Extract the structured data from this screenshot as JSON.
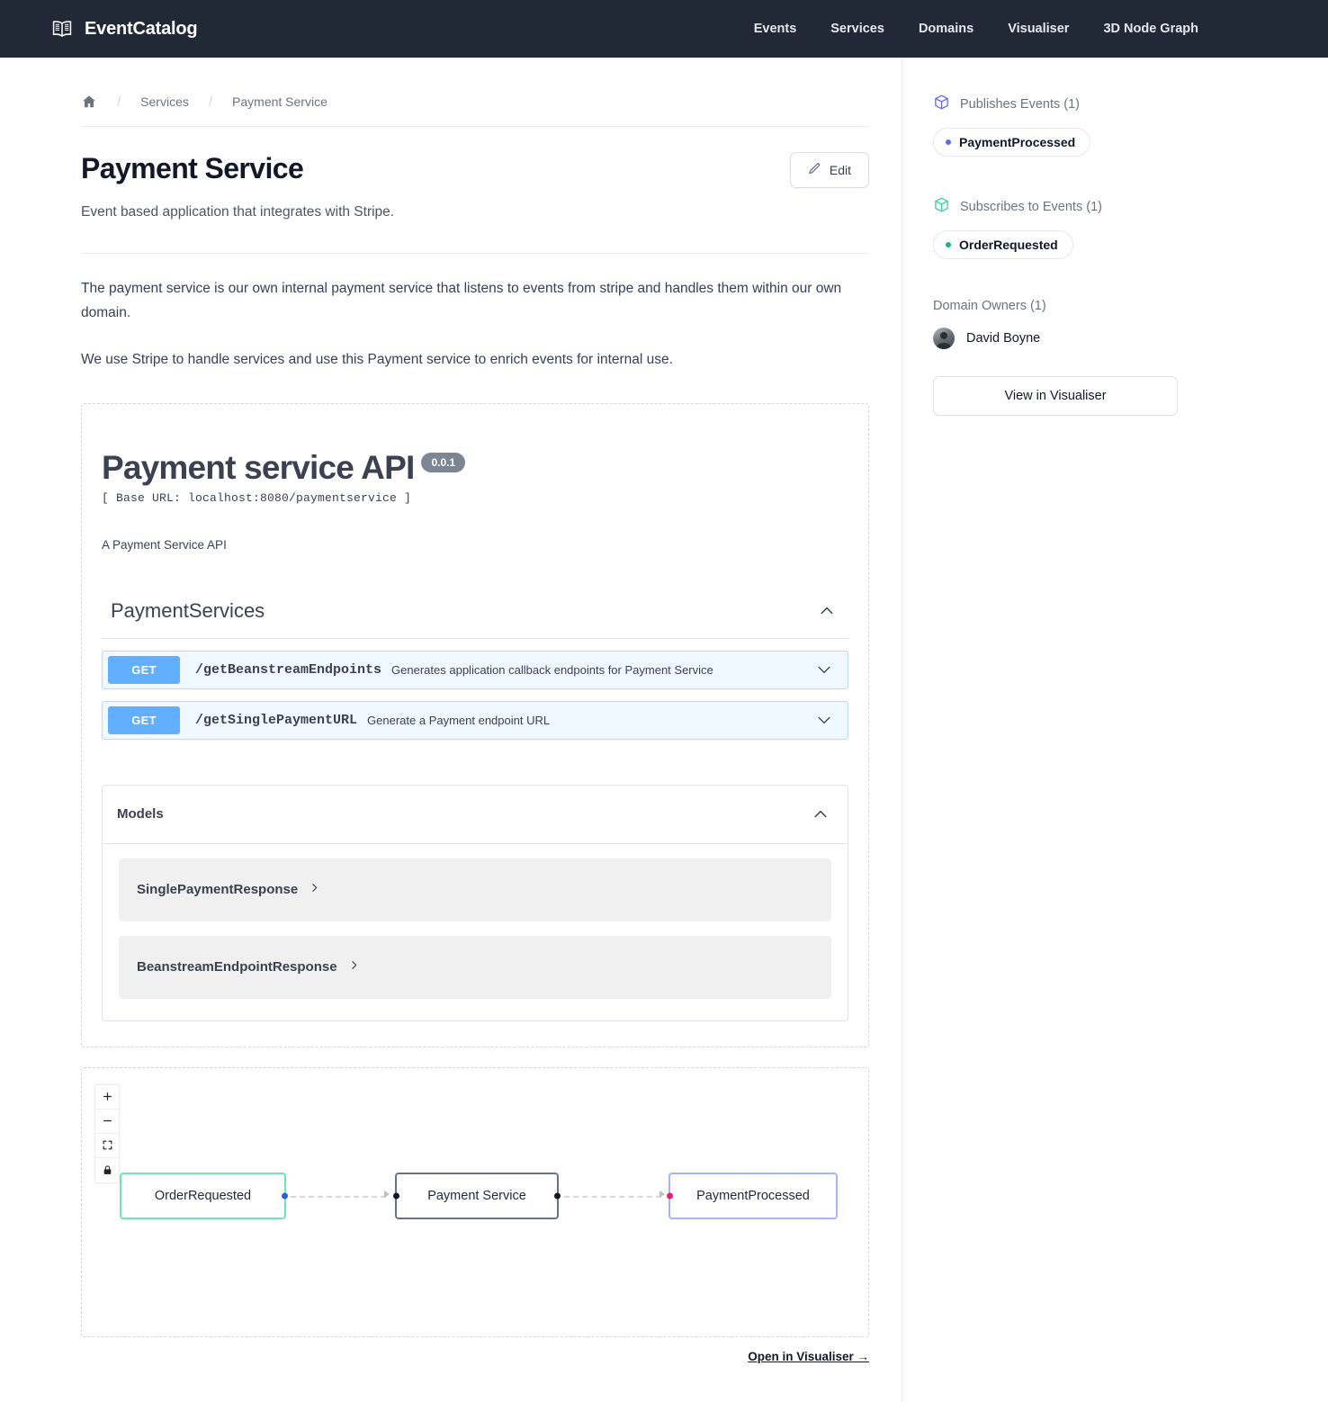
{
  "navbar": {
    "brand": "EventCatalog",
    "brand_icon": "open-book-icon",
    "links": [
      {
        "label": "Events"
      },
      {
        "label": "Services"
      },
      {
        "label": "Domains"
      },
      {
        "label": "Visualiser"
      },
      {
        "label": "3D Node Graph"
      }
    ]
  },
  "breadcrumb": {
    "home_icon": "home-icon",
    "separator": "/",
    "items": [
      {
        "label": "Services"
      },
      {
        "label": "Payment Service"
      }
    ]
  },
  "header": {
    "title": "Payment Service",
    "subtitle": "Event based application that integrates with Stripe.",
    "edit_label": "Edit",
    "edit_icon": "pencil-icon"
  },
  "body": {
    "paragraphs": [
      "The payment service is our own internal payment service that listens to events from stripe and handles them within our own domain.",
      "We use Stripe to handle services and use this Payment service to enrich events for internal use."
    ]
  },
  "openapi": {
    "title": "Payment service API",
    "version": "0.0.1",
    "base_url": "[ Base URL: localhost:8080/paymentservice ]",
    "description": "A Payment Service API",
    "tag_section": {
      "name": "PaymentServices",
      "collapse_icon": "chevron-up-icon",
      "operations": [
        {
          "method": "GET",
          "path": "/getBeanstreamEndpoints",
          "summary": "Generates application callback endpoints for Payment Service",
          "expand_icon": "chevron-down-icon"
        },
        {
          "method": "GET",
          "path": "/getSinglePaymentURL",
          "summary": "Generate a Payment endpoint URL",
          "expand_icon": "chevron-down-icon"
        }
      ]
    },
    "models": {
      "title": "Models",
      "collapse_icon": "chevron-up-icon",
      "items": [
        {
          "name": "SinglePaymentResponse",
          "expand_icon": "chevron-right-icon"
        },
        {
          "name": "BeanstreamEndpointResponse",
          "expand_icon": "chevron-right-icon"
        }
      ]
    }
  },
  "graph": {
    "controls": [
      {
        "name": "zoom-in",
        "glyph": "+"
      },
      {
        "name": "zoom-out",
        "glyph": "−"
      },
      {
        "name": "fit-view",
        "glyph": "⛶"
      },
      {
        "name": "toggle-interactivity",
        "glyph": "🔒"
      }
    ],
    "nodes": [
      {
        "label": "OrderRequested",
        "border_color": "#6ee7b7",
        "handle_color": "#2563eb"
      },
      {
        "label": "Payment Service",
        "border_color": "#64748b",
        "handle_color": "#111827"
      },
      {
        "label": "PaymentProcessed",
        "border_color": "#a5b4fc",
        "handle_color": "#ec1e63"
      }
    ],
    "open_link": "Open in Visualiser →"
  },
  "sidebar": {
    "publishes": {
      "icon": "cube-icon",
      "icon_color": "#6366f1",
      "title": "Publishes Events (1)",
      "events": [
        {
          "label": "PaymentProcessed",
          "dot_color": "#6366f1"
        }
      ]
    },
    "subscribes": {
      "icon": "cube-icon",
      "icon_color": "#34d399",
      "title": "Subscribes to Events (1)",
      "events": [
        {
          "label": "OrderRequested",
          "dot_color": "#10b981"
        }
      ]
    },
    "owners": {
      "title": "Domain Owners (1)",
      "people": [
        {
          "name": "David Boyne"
        }
      ]
    },
    "view_visualiser_label": "View in Visualiser"
  }
}
